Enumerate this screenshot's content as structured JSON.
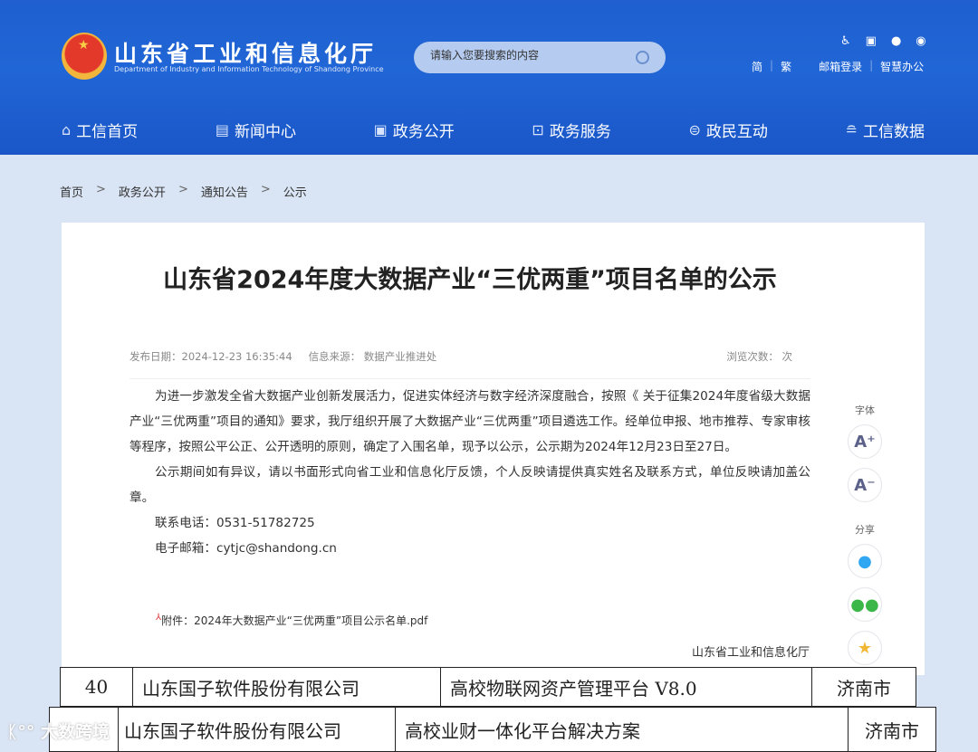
{
  "header": {
    "title": "山东省工业和信息化厅",
    "subtitle": "Department of Industry and Information Technology of Shandong Province",
    "search_placeholder": "请输入您要搜索的内容",
    "tools": [
      "accessibility-icon",
      "mobile-icon",
      "wechat-icon",
      "weibo-icon"
    ],
    "links": [
      "简",
      "繁",
      "邮箱登录",
      "智慧办公"
    ]
  },
  "nav": [
    {
      "label": "工信首页",
      "icon": "home-icon"
    },
    {
      "label": "新闻中心",
      "icon": "document-icon"
    },
    {
      "label": "政务公开",
      "icon": "monitor-icon"
    },
    {
      "label": "政务服务",
      "icon": "service-icon"
    },
    {
      "label": "政民互动",
      "icon": "chat-icon"
    },
    {
      "label": "工信数据",
      "icon": "database-icon"
    }
  ],
  "breadcrumb": [
    "首页",
    "政务公开",
    "通知公告",
    "公示"
  ],
  "article": {
    "title": "山东省2024年度大数据产业“三优两重”项目名单的公示",
    "date": "发布日期：2024-12-23 16:35:44",
    "source": "信息来源：  数据产业推进处",
    "views": "浏览次数：        次",
    "paragraphs": [
      "为进一步激发全省大数据产业创新发展活力，促进实体经济与数字经济深度融合，按照《 关于征集2024年度省级大数据产业“三优两重”项目的通知》要求，我厅组织开展了大数据产业“三优两重”项目遴选工作。经单位申报、地市推荐、专家审核等程序，按照公平公正、公开透明的原则，确定了入围名单，现予以公示，公示期为2024年12月23日至27日。",
      "公示期间如有异议，请以书面形式向省工业和信息化厅反馈，个人反映请提供真实姓名及联系方式，单位反映请加盖公章。",
      "联系电话：0531-51782725",
      "电子邮箱：cytjc@shandong.cn"
    ],
    "attachment": "附件：2024年大数据产业“三优两重”项目公示名单.pdf",
    "signature": "山东省工业和信息化厅"
  },
  "side": {
    "font_label": "字体",
    "share_label": "分享",
    "font_up": "A⁺",
    "font_down": "A⁻"
  },
  "table_rows": [
    [
      "40",
      "山东国子软件股份有限公司",
      "高校物联网资产管理平台  V8.0",
      "济南市"
    ],
    [
      "",
      "山东国子软件股份有限公司",
      "高校业财一体化平台解决方案",
      "济南市"
    ]
  ],
  "watermark": "大数跨境",
  "colors": {
    "header_blue": "#2166d6",
    "page_bg": "#d9e4f4"
  }
}
